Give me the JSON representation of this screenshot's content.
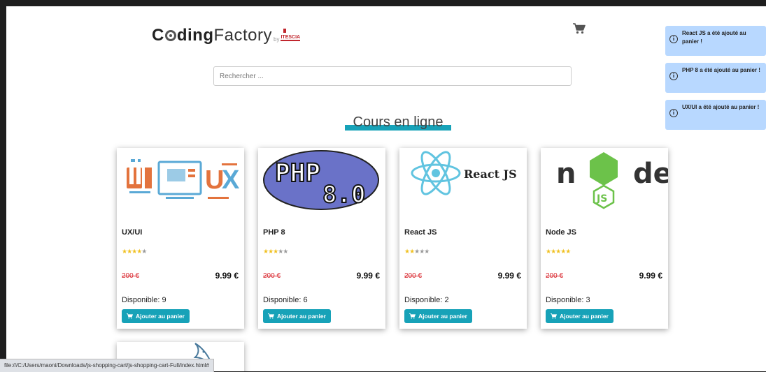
{
  "brand": {
    "coding": "C",
    "coding_rest": "ding",
    "factory": "Factory",
    "by": "by",
    "partner": "ITESCIA"
  },
  "search": {
    "placeholder": "Rechercher ..."
  },
  "section": {
    "title": "Cours en ligne"
  },
  "products": [
    {
      "name": "UX/UI",
      "rating": 4,
      "old_price": "200 €",
      "price": "9.99 €",
      "stock": "Disponible: 9",
      "button": "Ajouter au panier",
      "image_text": "UI UX"
    },
    {
      "name": "PHP 8",
      "rating": 3,
      "old_price": "200 €",
      "price": "9.99 €",
      "stock": "Disponible: 6",
      "button": "Ajouter au panier",
      "image_text": "PHP 8.0"
    },
    {
      "name": "React JS",
      "rating": 2,
      "old_price": "200 €",
      "price": "9.99 €",
      "stock": "Disponible: 2",
      "button": "Ajouter au panier",
      "image_text": "React JS"
    },
    {
      "name": "Node JS",
      "rating": 5,
      "old_price": "200 €",
      "price": "9.99 €",
      "stock": "Disponible: 3",
      "button": "Ajouter au panier",
      "image_text": "node"
    }
  ],
  "toasts": [
    {
      "text": "React JS a été ajouté au panier !"
    },
    {
      "text": "PHP 8 a été ajouté au panier !"
    },
    {
      "text": "UX/UI a été ajouté au panier !"
    }
  ],
  "status": {
    "url": "file:///C:/Users/maoni/Downloads/js-shopping-cart/js-shopping-cart-Full/index.html#"
  },
  "colors": {
    "accent": "#17a2b8",
    "old_price": "#d9262d",
    "star": "#f0c020",
    "toast_bg": "#b8d8ff"
  },
  "icons": {
    "cart": "shopping-cart-icon",
    "info": "info-circle-icon"
  }
}
